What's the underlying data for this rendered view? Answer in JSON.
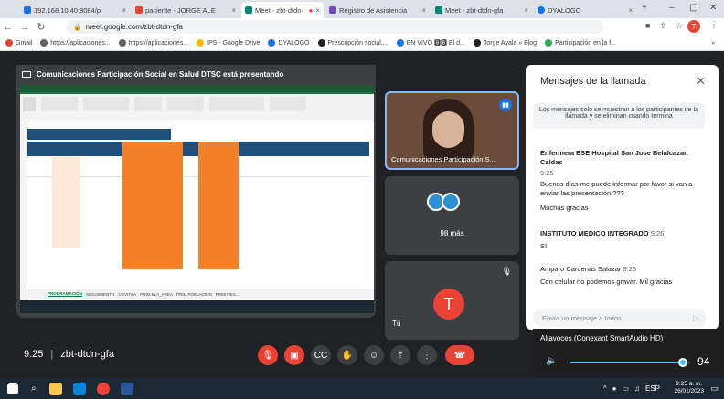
{
  "tabs": [
    {
      "label": "192.168.10.40:8084/p",
      "active": false,
      "color": "#1a73e8"
    },
    {
      "label": "paciente - JORGE ALE",
      "active": false,
      "color": "#ea4335"
    },
    {
      "label": "Meet - zbt-dtdn-",
      "active": true,
      "color": "#00897b"
    },
    {
      "label": "Registro de Asistencia",
      "active": false,
      "color": "#7248b9"
    },
    {
      "label": "Meet - zbt-dtdn-gfa",
      "active": false,
      "color": "#00897b"
    },
    {
      "label": "DYALOGO",
      "active": false,
      "color": "#1a73e8"
    }
  ],
  "address": {
    "url": "meet.google.com/zbt-dtdn-gfa"
  },
  "bookmarks": [
    {
      "label": "Gmail",
      "color": "#ea4335"
    },
    {
      "label": "https://aplicaciones...",
      "color": "#5f6368"
    },
    {
      "label": "https://aplicaciones...",
      "color": "#5f6368"
    },
    {
      "label": "IPS - Google Drive",
      "color": "#fbbc04"
    },
    {
      "label": "DYALOGO",
      "color": "#1a73e8"
    },
    {
      "label": "Prescripción social,...",
      "color": "#202124"
    },
    {
      "label": "EN VIVO 🅱🅱 El d...",
      "color": "#1a73e8"
    },
    {
      "label": "Jorge Ayala » Blog",
      "color": "#202124"
    },
    {
      "label": "Participación en la f...",
      "color": "#34a853"
    }
  ],
  "bookmarks_more": "»",
  "presentation": {
    "banner": "Comunicaciones Participación Social en Salud DTSC está presentando",
    "sheet_tabs": [
      "PROGRAMACIÓN",
      "SEGUIMIENTO",
      "COVITSA",
      "PRIM ELA_AREA",
      "PRIM POBLACION",
      "PRIM NEG..."
    ]
  },
  "participants": [
    {
      "name": "Comunicaciones Participación S...",
      "type": "video"
    },
    {
      "name": "98 más",
      "type": "more"
    },
    {
      "name": "Tú",
      "initial": "T",
      "type": "self"
    }
  ],
  "chat": {
    "title": "Mensajes de la llamada",
    "notice": "Los mensajes solo se muestran a los participantes de la llamada y se eliminan cuando termina",
    "messages": [
      {
        "sender": "Enfermera ESE Hospital San Jose Belalcazar, Caldas",
        "time": "9:25",
        "lines": [
          "Buenos días me puede informar por favor si van a enviar las presentación ???",
          "Muchas gracias"
        ]
      },
      {
        "sender": "INSTITUTO MEDICO INTEGRADO",
        "time": "9:26",
        "lines": [
          "SI"
        ]
      },
      {
        "sender": "Amparo Cardenas Salazar",
        "time": "9:26",
        "lines": [
          "Con celular no podemos gravar.  Mil gracias"
        ]
      }
    ],
    "input_placeholder": "Envía un mensaje a todos"
  },
  "volume": {
    "device": "Altavoces (Conexant SmartAudio HD)",
    "level": 94
  },
  "meeting": {
    "time": "9:25",
    "code": "zbt-dtdn-gfa"
  },
  "taskbar": {
    "time": "9:25 a. m.",
    "date": "26/01/2023",
    "lang": "ESP"
  },
  "colors": {
    "accent": "#8ab4f8",
    "end_call": "#ea4335",
    "excel_header": "#1e4e79",
    "excel_orange": "#f4812a"
  }
}
